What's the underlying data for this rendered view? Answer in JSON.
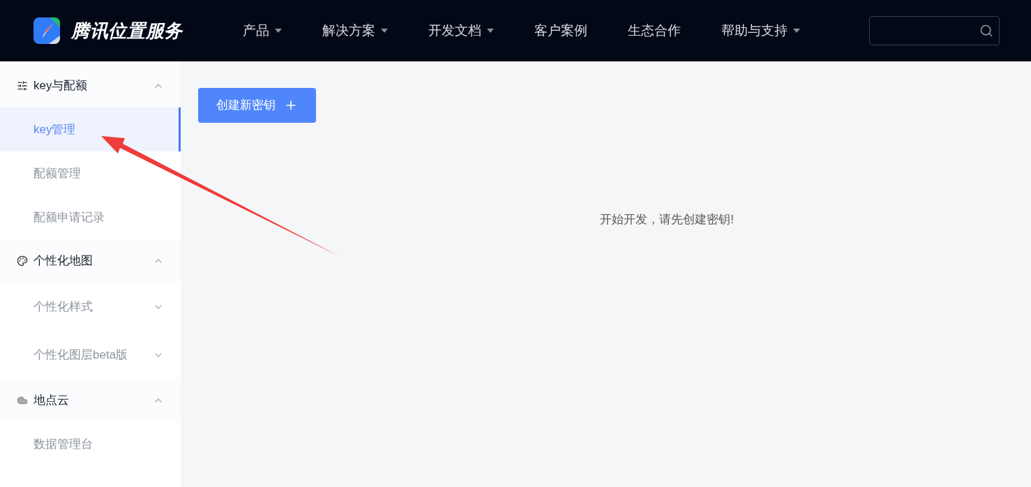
{
  "header": {
    "logo_text": "腾讯位置服务",
    "nav": [
      {
        "label": "产品",
        "has_menu": true
      },
      {
        "label": "解决方案",
        "has_menu": true
      },
      {
        "label": "开发文档",
        "has_menu": true
      },
      {
        "label": "客户案例",
        "has_menu": false
      },
      {
        "label": "生态合作",
        "has_menu": false
      },
      {
        "label": "帮助与支持",
        "has_menu": true
      }
    ]
  },
  "sidebar": {
    "groups": [
      {
        "kind": "sliders",
        "title": "key与配额",
        "expanded": true,
        "children": [
          {
            "label": "key管理",
            "selected": true
          },
          {
            "label": "配额管理",
            "selected": false
          },
          {
            "label": "配额申请记录",
            "selected": false
          }
        ]
      },
      {
        "kind": "palette",
        "title": "个性化地图",
        "expanded": true,
        "children": [
          {
            "label": "个性化样式",
            "selected": false,
            "expanded": false
          },
          {
            "label": "个性化图层beta版",
            "selected": false,
            "expanded": false
          }
        ]
      },
      {
        "kind": "cloud",
        "title": "地点云",
        "expanded": true,
        "children": [
          {
            "label": "数据管理台",
            "selected": false
          }
        ]
      }
    ]
  },
  "main": {
    "create_button": "创建新密钥",
    "empty_message": "开始开发，请先创建密钥!"
  }
}
